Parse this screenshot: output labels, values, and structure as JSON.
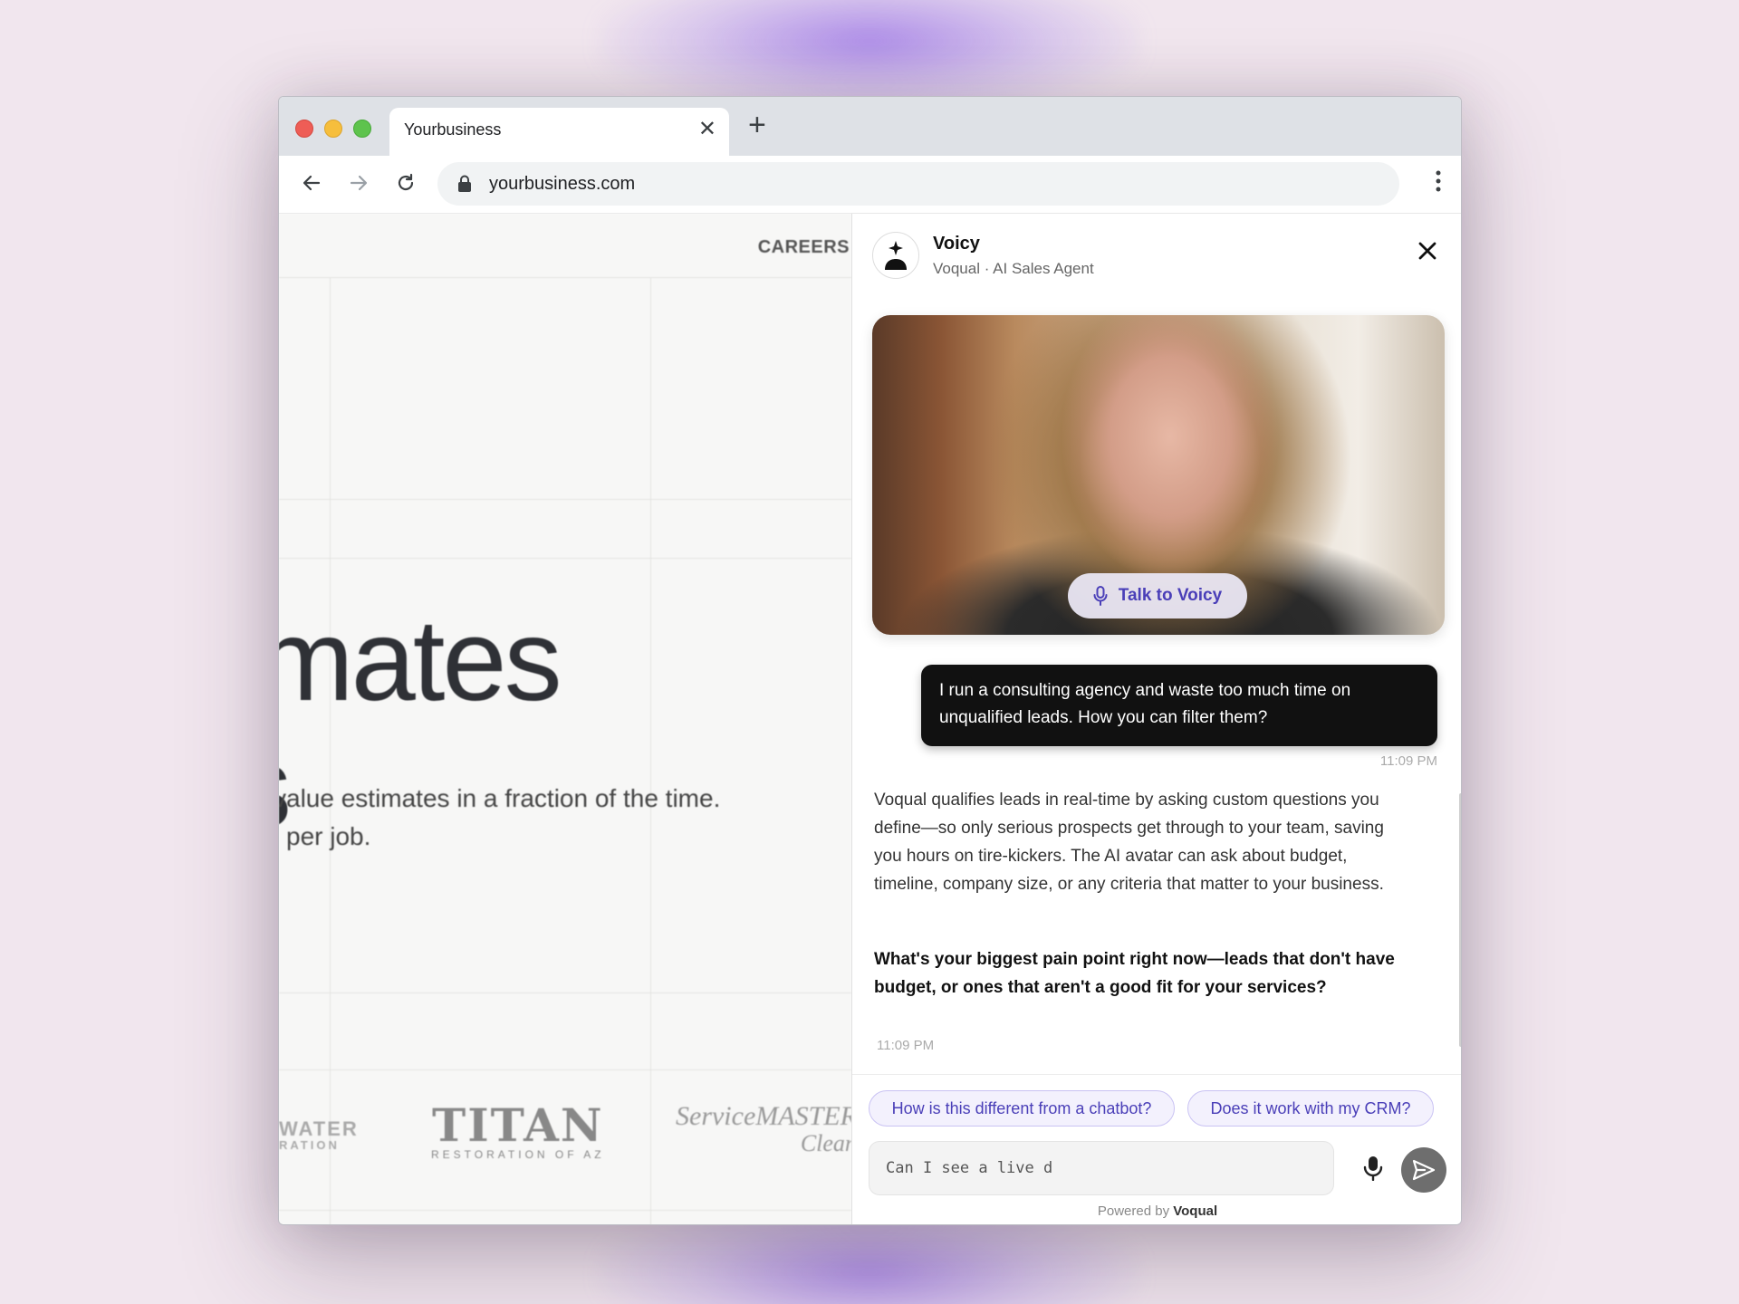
{
  "browser": {
    "tab_title": "Yourbusiness",
    "tab_close": "✕",
    "new_tab": "+",
    "url": "yourbusiness.com"
  },
  "website": {
    "nav_careers": "CAREERS",
    "hero_line1": "mates",
    "hero_line2": "s",
    "subtitle_line1": "value estimates in a fraction of the time.",
    "subtitle_line2": "per job.",
    "logos": {
      "water_top": "WATER",
      "water_bottom": "RATION",
      "titan_name": "TITAN",
      "titan_sub": "RESTORATION OF AZ",
      "servicemaster_name": "ServiceMASTER",
      "servicemaster_sub": "Clean"
    }
  },
  "chat": {
    "agent_name": "Voicy",
    "agent_subtitle": "Voqual · AI Sales Agent",
    "talk_button": "Talk to Voicy",
    "messages": [
      {
        "role": "user",
        "text": "I run a consulting agency and waste too much time on unqualified leads. How you can filter them?",
        "time": "11:09 PM"
      },
      {
        "role": "agent",
        "text": "Voqual qualifies leads in real-time by asking custom questions you define—so only serious prospects get through to your team, saving you hours on tire-kickers. The AI avatar can ask about budget, timeline, company size, or any criteria that matter to your business.",
        "bold_text": "What's your biggest pain point right now—leads that don't have budget, or ones that aren't a good fit for your services?",
        "time": "11:09 PM"
      }
    ],
    "suggestions": [
      "How is this different from a chatbot?",
      "Does it work with my CRM?"
    ],
    "input_value": "Can I see a live d",
    "powered_by_prefix": "Powered by",
    "powered_by_brand": "Voqual"
  },
  "colors": {
    "accent": "#4a3fb8",
    "chip_bg": "#f3f1fd",
    "user_bubble": "#111111",
    "page_bg": "#f1e6ee"
  }
}
